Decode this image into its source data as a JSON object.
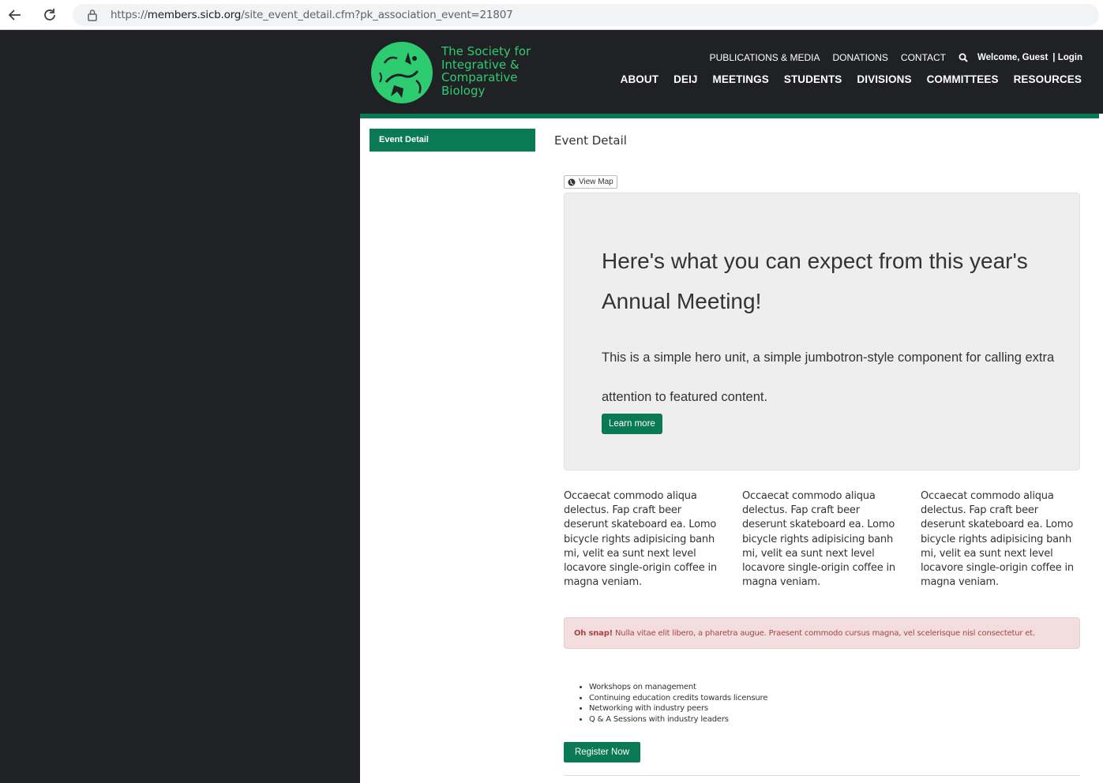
{
  "browser": {
    "url_scheme": "https://",
    "url_host": "members.sicb.org",
    "url_path": "/site_event_detail.cfm?pk_association_event=21807"
  },
  "header": {
    "logo_lines": [
      "The Society for",
      "Integrative &",
      "Comparative",
      "Biology"
    ],
    "top_links": [
      "PUBLICATIONS & MEDIA",
      "DONATIONS",
      "CONTACT"
    ],
    "welcome": "Welcome, Guest",
    "login": "| Login",
    "main_nav": [
      "ABOUT",
      "DEIJ",
      "MEETINGS",
      "STUDENTS",
      "DIVISIONS",
      "COMMITTEES",
      "RESOURCES"
    ]
  },
  "sidebar": {
    "active_item": "Event Detail"
  },
  "main": {
    "heading": "Event Detail",
    "view_map": "View Map",
    "hero": {
      "title": "Here's what you can expect from this year's Annual Meeting!",
      "text": "This is a simple hero unit, a simple jumbotron-style component for calling extra attention to featured content.",
      "button": "Learn more"
    },
    "columns": [
      "Occaecat commodo aliqua delectus. Fap craft beer deserunt skateboard ea. Lomo bicycle rights adipisicing banh mi, velit ea sunt next level locavore single-origin coffee in magna veniam.",
      "Occaecat commodo aliqua delectus. Fap craft beer deserunt skateboard ea. Lomo bicycle rights adipisicing banh mi, velit ea sunt next level locavore single-origin coffee in magna veniam.",
      "Occaecat commodo aliqua delectus. Fap craft beer deserunt skateboard ea. Lomo bicycle rights adipisicing banh mi, velit ea sunt next level locavore single-origin coffee in magna veniam."
    ],
    "alert": {
      "strong": "Oh snap!",
      "text": " Nulla vitae elit libero, a pharetra augue. Praesent commodo cursus magna, vel scelerisque nisl consectetur et."
    },
    "bullets": [
      "Workshops on management",
      "Continuing education credits towards licensure",
      "Networking with industry peers",
      "Q & A Sessions with industry leaders"
    ],
    "register_button": "Register Now"
  },
  "colors": {
    "brand_green": "#0a7a55",
    "logo_green": "#2ecc71",
    "header_bg": "#202124",
    "alert_text": "#a94442"
  },
  "icons": [
    "back-arrow-icon",
    "reload-icon",
    "lock-icon",
    "search-icon",
    "globe-icon"
  ]
}
